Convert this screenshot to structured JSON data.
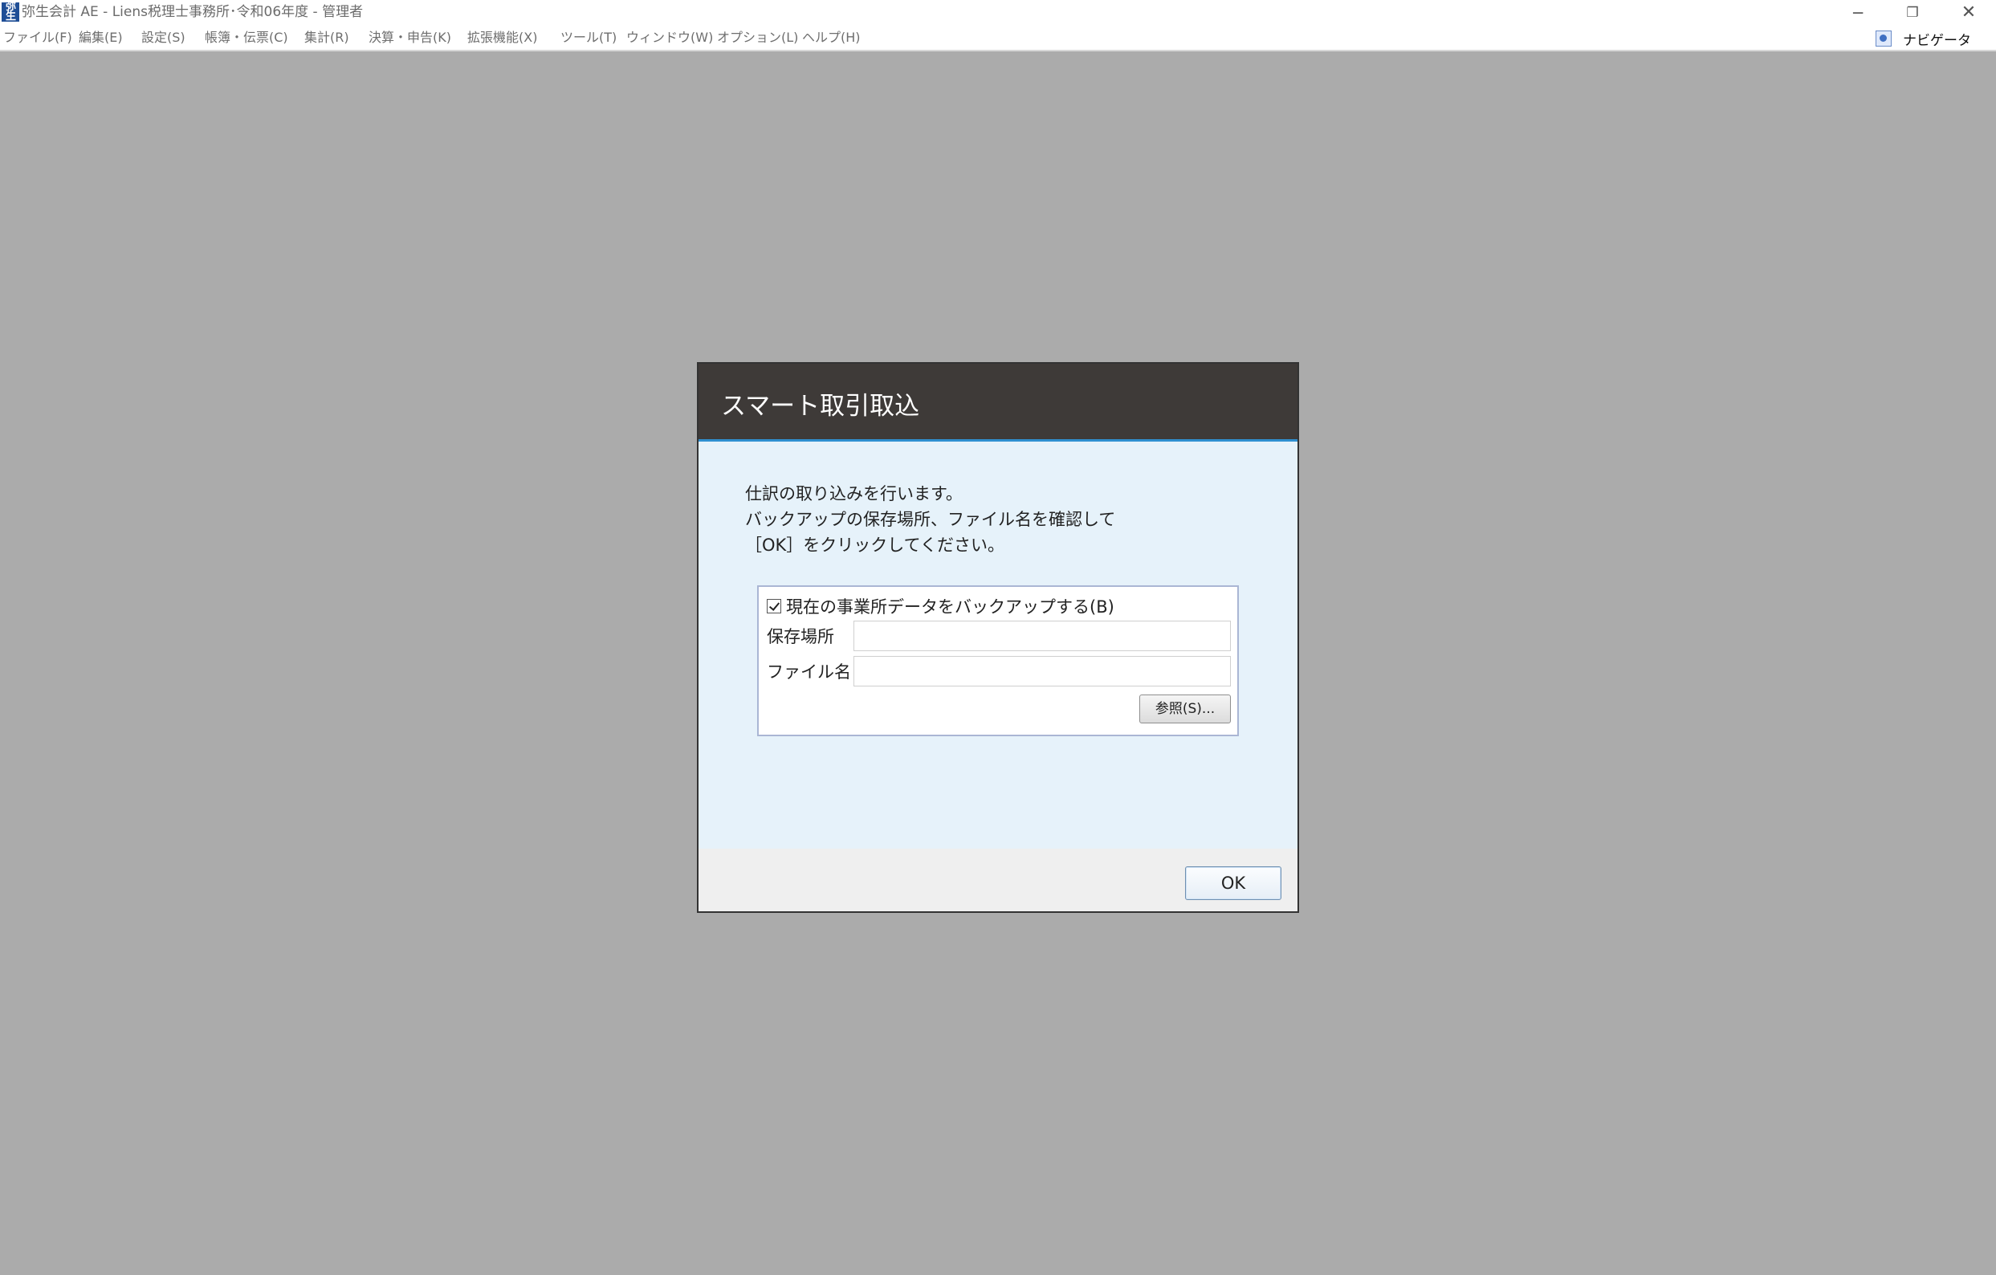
{
  "window": {
    "title": "弥生会計 AE - Liens税理士事務所･令和06年度 - 管理者",
    "icon_text": "弥生",
    "controls": {
      "minimize": "─",
      "maximize": "❐",
      "close": "✕"
    }
  },
  "menubar": {
    "items": [
      {
        "label": "ファイル(F)"
      },
      {
        "label": "編集(E)"
      },
      {
        "label": "設定(S)"
      },
      {
        "label": "帳簿・伝票(C)"
      },
      {
        "label": "集計(R)"
      },
      {
        "label": "決算・申告(K)"
      },
      {
        "label": "拡張機能(X)"
      },
      {
        "label": "ツール(T)"
      },
      {
        "label": "ウィンドウ(W)"
      },
      {
        "label": "オプション(L)"
      },
      {
        "label": "ヘルプ(H)"
      }
    ],
    "navigator_label": "ナビゲータ"
  },
  "dialog": {
    "title": "スマート取引取込",
    "message_lines": [
      "仕訳の取り込みを行います。",
      "バックアップの保存場所、ファイル名を確認して",
      "［OK］をクリックしてください。"
    ],
    "backup": {
      "checkbox_label": "現在の事業所データをバックアップする(B)",
      "checked": true,
      "location_label": "保存場所",
      "location_value": "",
      "filename_label": "ファイル名",
      "filename_value": "",
      "browse_label": "参照(S)..."
    },
    "ok_label": "OK"
  }
}
